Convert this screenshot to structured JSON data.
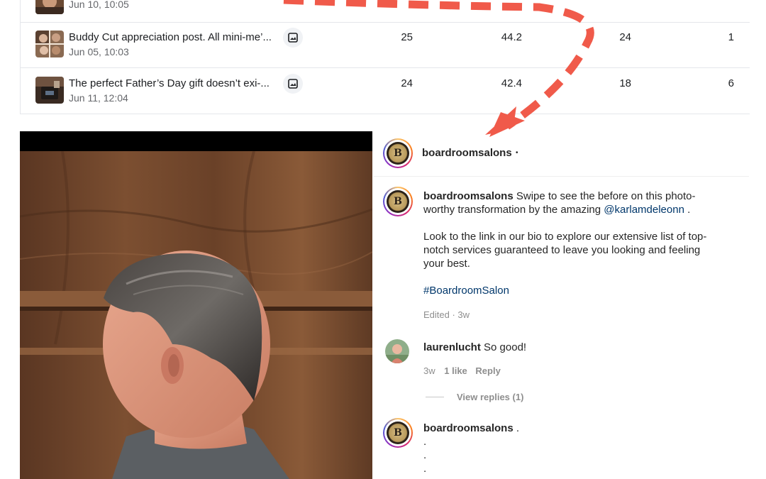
{
  "table": {
    "rows": [
      {
        "title": "",
        "date": "Jun 10, 10:05",
        "media_type_icon": "image-icon",
        "metrics": []
      },
      {
        "title": "Buddy Cut appreciation post. All mini-me’...",
        "date": "Jun 05, 10:03",
        "media_type_icon": "image-icon",
        "metrics": [
          "25",
          "44.2",
          "24",
          "1"
        ]
      },
      {
        "title": "The perfect Father’s Day gift doesn’t exi-...",
        "date": "Jun 11, 12:04",
        "media_type_icon": "image-icon",
        "metrics": [
          "24",
          "42.4",
          "18",
          "6"
        ]
      }
    ]
  },
  "post": {
    "header_username": "boardroomsalons",
    "header_dot": "•",
    "caption": {
      "username": "boardroomsalons",
      "line1": "Swipe to see the before on this photo-",
      "line2_prefix": "worthy transformation by the amazing ",
      "mention": "@karlamdeleonn",
      "line2_suffix": " .",
      "para2_line1": "Look to the link in our bio to explore our extensive list of top-",
      "para2_line2": "notch services guaranteed to leave you looking and feeling",
      "para2_line3": "your best.",
      "hashtag": "#BoardroomSalon",
      "edited": "Edited · 3w"
    },
    "comments": [
      {
        "username": "laurenlucht",
        "text": "So good!",
        "time": "3w",
        "likes": "1 like",
        "reply": "Reply",
        "view_replies": "View replies (1)"
      },
      {
        "username": "boardroomsalons",
        "text": ".",
        "dots": [
          ".",
          ".",
          "."
        ]
      }
    ]
  },
  "colors": {
    "annotation_arrow": "#f05a4a",
    "link": "#00376b",
    "muted": "#8e8e8e"
  },
  "avatar_logo_letter": "B"
}
